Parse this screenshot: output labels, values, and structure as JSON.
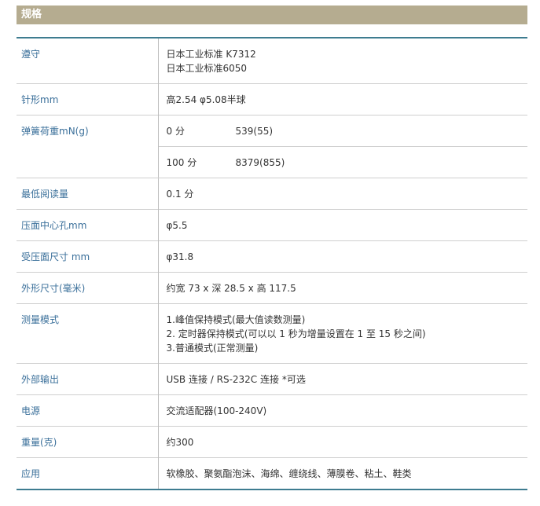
{
  "title": "规格",
  "rows": [
    {
      "label": "遵守",
      "lines": [
        "日本工业标准 K7312",
        "日本工业标准6050"
      ]
    },
    {
      "label": "针形mm",
      "lines": [
        "高2.54 φ5.08半球"
      ]
    },
    {
      "label": "弹簧荷重mN(g)",
      "pairs": [
        [
          "0 分",
          "539(55)"
        ],
        [
          "100 分",
          "8379(855)"
        ]
      ]
    },
    {
      "label": "最低阅读量",
      "lines": [
        "0.1 分"
      ]
    },
    {
      "label": "压面中心孔mm",
      "lines": [
        "φ5.5"
      ]
    },
    {
      "label": "受压面尺寸 mm",
      "lines": [
        "φ31.8"
      ]
    },
    {
      "label": "外形尺寸(毫米)",
      "lines": [
        "约宽 73 x 深 28.5 x 高 117.5"
      ]
    },
    {
      "label": "测量模式",
      "lines": [
        "1.峰值保持模式(最大值读数测量)",
        "2. 定时器保持模式(可以以 1 秒为增量设置在 1 至 15 秒之间)",
        "3.普通模式(正常测量)"
      ]
    },
    {
      "label": "外部输出",
      "lines": [
        "USB 连接 / RS-232C 连接 *可选"
      ]
    },
    {
      "label": "电源",
      "lines": [
        "交流适配器(100-240V)"
      ]
    },
    {
      "label": "重量(克)",
      "lines": [
        "约300"
      ]
    },
    {
      "label": "应用",
      "lines": [
        "软橡胶、聚氨酯泡沫、海绵、缠绕线、薄膜卷、粘土、鞋类"
      ]
    }
  ]
}
